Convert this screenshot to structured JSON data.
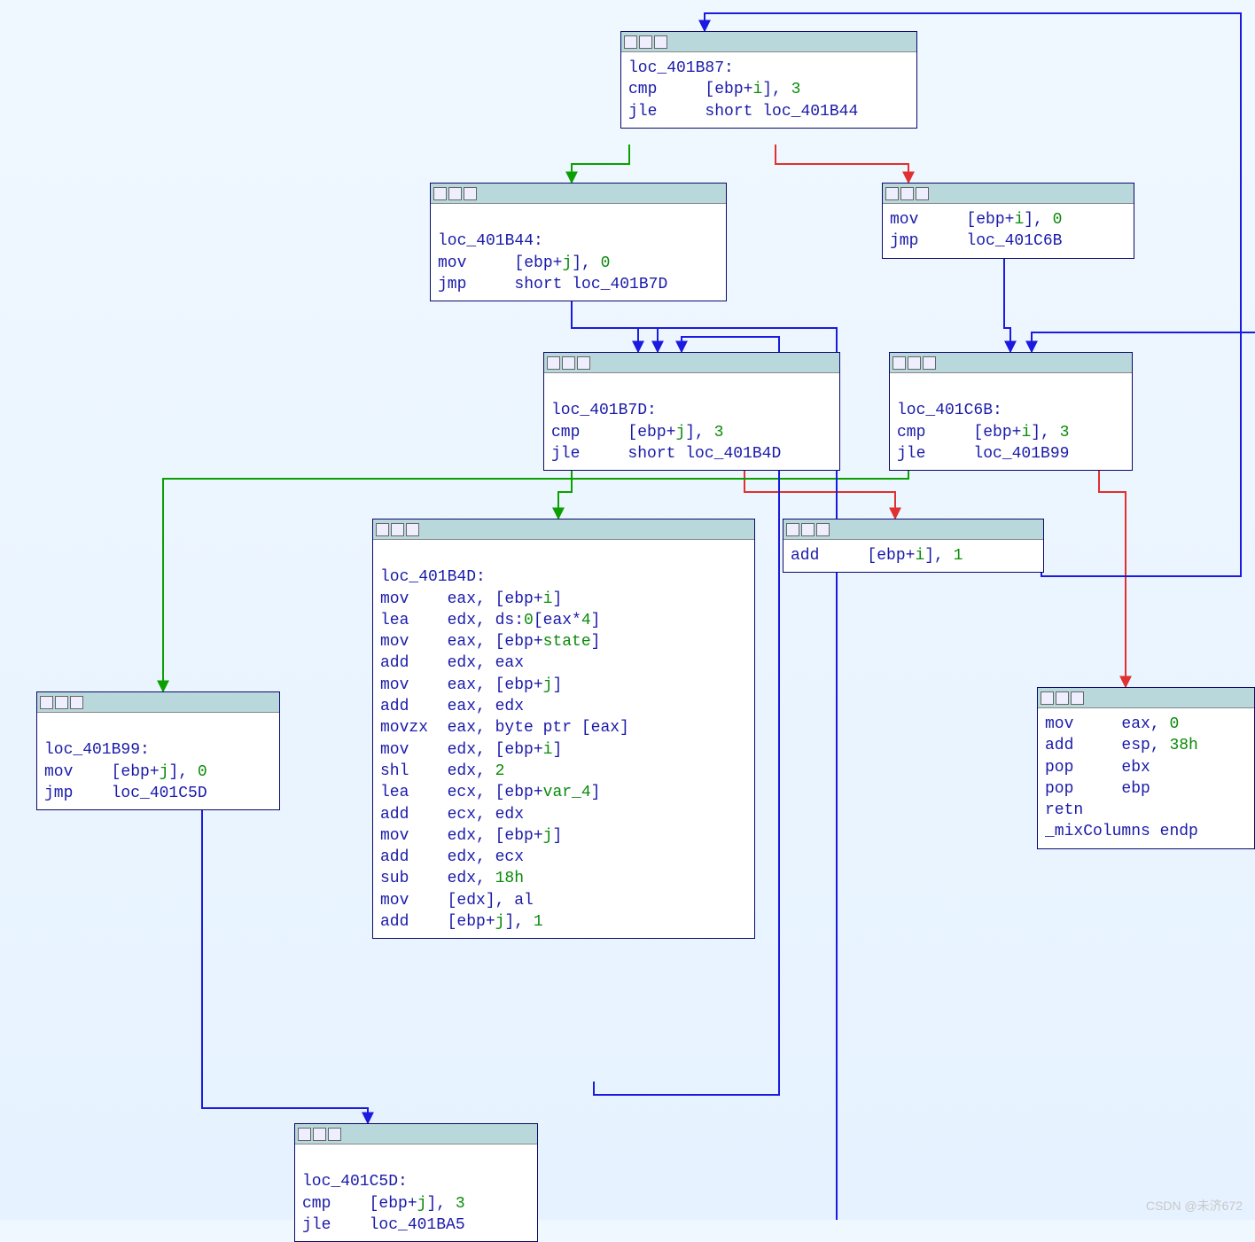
{
  "colors": {
    "true_edge": "#0aa000",
    "false_edge": "#e03030",
    "uncond_edge": "#1a1ae0"
  },
  "watermark": "CSDN @未济672",
  "nodes": {
    "n1": {
      "label": "loc_401B87:",
      "lines": [
        [
          "cmp",
          "[ebp+",
          "i",
          "], ",
          "3"
        ],
        [
          "jle",
          "short ",
          "loc_401B44"
        ]
      ]
    },
    "n2": {
      "label": "loc_401B44:",
      "lines": [
        [
          "mov",
          "[ebp+",
          "j",
          "], ",
          "0"
        ],
        [
          "jmp",
          "short ",
          "loc_401B7D"
        ]
      ]
    },
    "n3": {
      "lines": [
        [
          "mov",
          "[ebp+",
          "i",
          "], ",
          "0"
        ],
        [
          "jmp",
          "",
          "loc_401C6B"
        ]
      ]
    },
    "n4": {
      "label": "loc_401B7D:",
      "lines": [
        [
          "cmp",
          "[ebp+",
          "j",
          "], ",
          "3"
        ],
        [
          "jle",
          "short ",
          "loc_401B4D"
        ]
      ]
    },
    "n5": {
      "label": "loc_401C6B:",
      "lines": [
        [
          "cmp",
          "[ebp+",
          "i",
          "], ",
          "3"
        ],
        [
          "jle",
          "",
          "loc_401B99"
        ]
      ]
    },
    "n6": {
      "lines": [
        [
          "add",
          "[ebp+",
          "i",
          "], ",
          "1"
        ]
      ]
    },
    "n7": {
      "label": "loc_401B4D:",
      "lines": [
        [
          "mov",
          "eax, [ebp+",
          "i",
          "]"
        ],
        [
          "lea",
          "edx, ds:",
          "0",
          "[eax*",
          "4",
          "]"
        ],
        [
          "mov",
          "eax, [ebp+",
          "state",
          "]"
        ],
        [
          "add",
          "edx, eax"
        ],
        [
          "mov",
          "eax, [ebp+",
          "j",
          "]"
        ],
        [
          "add",
          "eax, edx"
        ],
        [
          "movzx",
          "eax, byte ptr [eax]"
        ],
        [
          "mov",
          "edx, [ebp+",
          "i",
          "]"
        ],
        [
          "shl",
          "edx, ",
          "2"
        ],
        [
          "lea",
          "ecx, [ebp+",
          "var_4",
          "]"
        ],
        [
          "add",
          "ecx, edx"
        ],
        [
          "mov",
          "edx, [ebp+",
          "j",
          "]"
        ],
        [
          "add",
          "edx, ecx"
        ],
        [
          "sub",
          "edx, ",
          "18h"
        ],
        [
          "mov",
          "[edx], al"
        ],
        [
          "add",
          "[ebp+",
          "j",
          "], ",
          "1"
        ]
      ]
    },
    "n8": {
      "label": "loc_401B99:",
      "lines": [
        [
          "mov",
          "[ebp+",
          "j",
          "], ",
          "0"
        ],
        [
          "jmp",
          "",
          "loc_401C5D"
        ]
      ]
    },
    "n9": {
      "lines": [
        [
          "mov",
          "eax, ",
          "0"
        ],
        [
          "add",
          "esp, ",
          "38h"
        ],
        [
          "pop",
          "ebx"
        ],
        [
          "pop",
          "ebp"
        ],
        [
          "retn",
          ""
        ],
        [
          "_mixColumns",
          "endp"
        ]
      ]
    },
    "n10": {
      "label": "loc_401C5D:",
      "lines": [
        [
          "cmp",
          "[ebp+",
          "j",
          "], ",
          "3"
        ],
        [
          "jle",
          "",
          "loc_401BA5"
        ]
      ]
    }
  }
}
